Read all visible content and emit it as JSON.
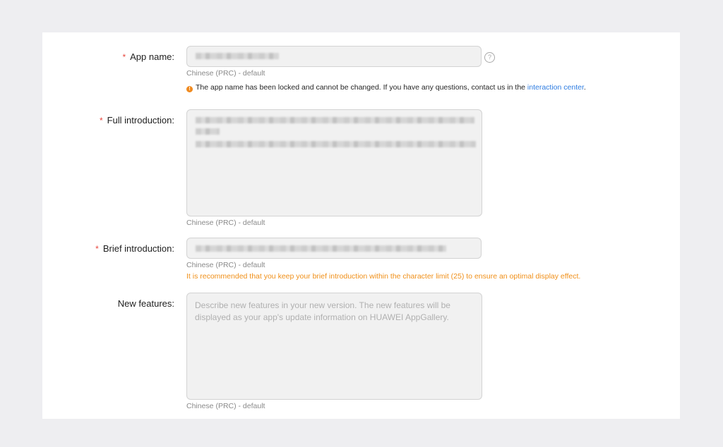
{
  "form": {
    "app_name": {
      "label": "App name:",
      "required_mark": "*",
      "caption": "Chinese (PRC) - default",
      "help_icon": "question-circle-icon",
      "notice_text": "The app name has been locked and cannot be changed. If you have any questions, contact us in the ",
      "notice_link": "interaction center",
      "notice_end": ".",
      "notice_icon": "warning-icon"
    },
    "full_intro": {
      "label": "Full introduction:",
      "required_mark": "*",
      "caption": "Chinese (PRC) - default"
    },
    "brief_intro": {
      "label": "Brief introduction:",
      "required_mark": "*",
      "caption": "Chinese (PRC) - default",
      "hint": "It is recommended that you keep your brief introduction within the character limit (25) to ensure an optimal display effect."
    },
    "new_features": {
      "label": "New features:",
      "placeholder": "Describe new features in your new version. The new features will be displayed as your app's update information on HUAWEI AppGallery.",
      "caption": "Chinese (PRC) - default"
    }
  },
  "colors": {
    "required": "#e8473e",
    "warning": "#f0901a",
    "link": "#2f7de1",
    "field_bg": "#f1f1f1"
  }
}
